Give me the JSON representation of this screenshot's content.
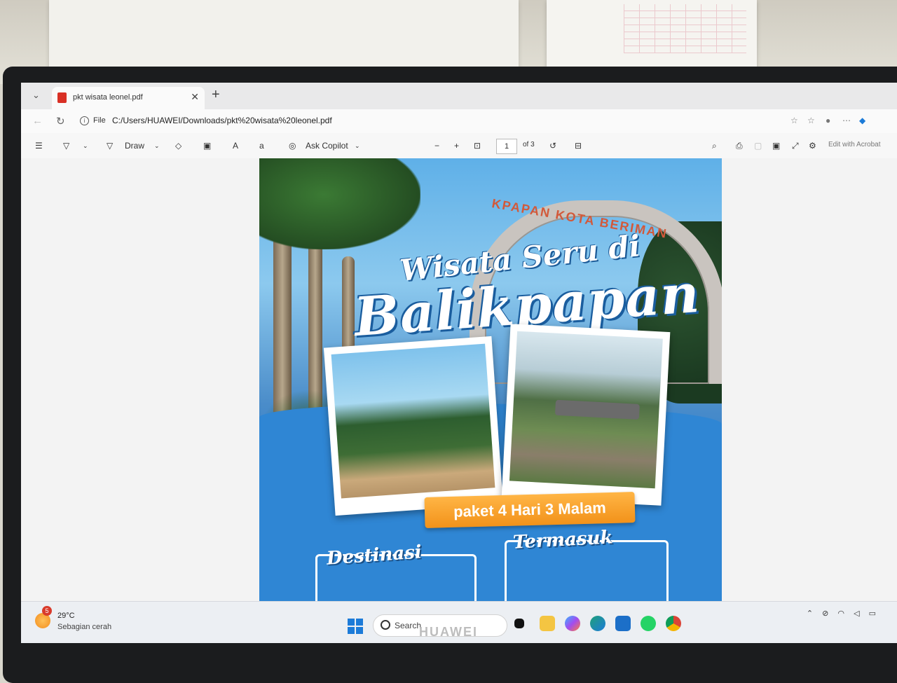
{
  "monitor_brand": "HUAWEI",
  "browser": {
    "tab_title": "pkt wisata leonel.pdf",
    "address": {
      "scheme_label": "File",
      "url": "C:/Users/HUAWEI/Downloads/pkt%20wisata%20leonel.pdf"
    }
  },
  "pdf_toolbar": {
    "draw_label": "Draw",
    "copilot_label": "Ask Copilot",
    "page_current": "1",
    "page_total_label": "of 3",
    "edit_label": "Edit with Acrobat"
  },
  "poster": {
    "arch_text": "KPAPAN KOTA BERIMAN",
    "title_line1": "Wisata Seru di",
    "title_line2": "Balikpapan",
    "package_badge": "paket 4 Hari 3 Malam",
    "section_left": "Destinasi",
    "section_right": "Termasuk"
  },
  "taskbar": {
    "weather_temp": "29°C",
    "weather_desc": "Sebagian cerah",
    "weather_badge": "5",
    "search_label": "Search"
  },
  "colors": {
    "poster_blue": "#2f86d4",
    "badge_orange": "#f2921a",
    "taskbar_bg": "#eceff3"
  }
}
